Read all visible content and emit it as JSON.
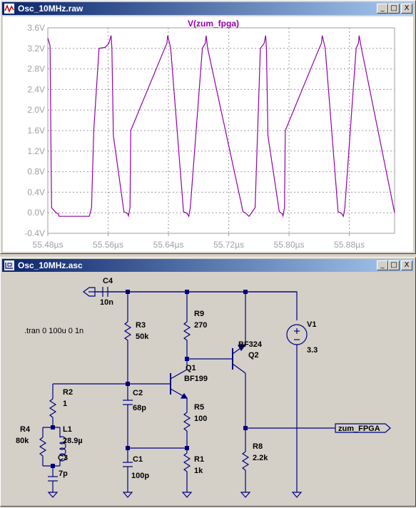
{
  "waveform_window": {
    "title": "Osc_10MHz.raw",
    "trace_label": "V(zum_fpga)",
    "buttons": {
      "minimize": "_",
      "maximize": "□",
      "close": "X"
    }
  },
  "schematic_window": {
    "title": "Osc_10MHz.asc",
    "buttons": {
      "minimize": "_",
      "maximize": "□",
      "close": "X"
    },
    "directive": ".tran 0 100u 0 1n",
    "net_label": "zum_FPGA",
    "components": {
      "c4": {
        "name": "C4",
        "value": "10n"
      },
      "r3": {
        "name": "R3",
        "value": "50k"
      },
      "r9": {
        "name": "R9",
        "value": "270"
      },
      "q2": {
        "name": "Q2",
        "model": "BF324"
      },
      "v1": {
        "name": "V1",
        "value": "3.3"
      },
      "q1": {
        "name": "Q1",
        "model": "BF199"
      },
      "r2": {
        "name": "R2",
        "value": "1"
      },
      "c2": {
        "name": "C2",
        "value": "68p"
      },
      "r5": {
        "name": "R5",
        "value": "100"
      },
      "r4": {
        "name": "R4",
        "value": "80k"
      },
      "l1": {
        "name": "L1",
        "value": "28.9µ"
      },
      "r8": {
        "name": "R8",
        "value": "2.2k"
      },
      "c3": {
        "name": "C3",
        "value": "7p"
      },
      "c1": {
        "name": "C1",
        "value": "100p"
      },
      "r1": {
        "name": "R1",
        "value": "1k"
      }
    }
  },
  "colors": {
    "trace": "#9400a8",
    "grid": "#9c9c9c",
    "axis_text": "#a0a0a0",
    "wire": "#000080",
    "schematic_bg": "#d4d0c8",
    "title_active": "#0a246a"
  },
  "chart_data": {
    "type": "line",
    "title": "V(zum_fpga)",
    "xlabel": "",
    "ylabel": "",
    "x_ticks": [
      "55.48µs",
      "55.56µs",
      "55.64µs",
      "55.72µs",
      "55.80µs",
      "55.88µs"
    ],
    "y_ticks": [
      "3.6V",
      "3.2V",
      "2.8V",
      "2.4V",
      "2.0V",
      "1.6V",
      "1.2V",
      "0.8V",
      "0.4V",
      "0.0V",
      "-0.4V"
    ],
    "xlim": [
      55.48,
      55.94
    ],
    "ylim": [
      -0.4,
      3.6
    ],
    "grid": true,
    "series": [
      {
        "name": "V(zum_fpga)",
        "x": [
          55.48,
          55.483,
          55.484,
          55.485,
          55.491,
          55.494,
          55.495,
          55.535,
          55.538,
          55.541,
          55.548,
          55.556,
          55.561,
          55.564,
          55.565,
          55.567,
          55.581,
          55.586,
          55.587,
          55.589,
          55.59,
          55.635,
          55.638,
          55.639,
          55.643,
          55.66,
          55.663,
          55.665,
          55.667,
          55.669,
          55.685,
          55.689,
          55.69,
          55.692,
          55.739,
          55.742,
          55.743,
          55.747,
          55.755,
          55.762,
          55.767,
          55.769,
          55.77,
          55.772,
          55.787,
          55.791,
          55.792,
          55.794,
          55.795,
          55.84,
          55.843,
          55.844,
          55.848,
          55.865,
          55.868,
          55.87,
          55.872,
          55.874,
          55.889,
          55.892,
          55.893,
          55.896,
          55.94
        ],
        "y": [
          3.4,
          3.25,
          1.6,
          0.1,
          0.0,
          -0.02,
          -0.07,
          -0.07,
          0.1,
          1.6,
          3.2,
          3.22,
          3.3,
          3.45,
          3.2,
          1.5,
          0.02,
          -0.02,
          -0.06,
          0.1,
          1.6,
          3.2,
          3.3,
          3.45,
          3.2,
          0.02,
          0.0,
          -0.02,
          -0.07,
          0.1,
          3.2,
          3.3,
          3.45,
          3.2,
          0.02,
          0.0,
          -0.02,
          -0.07,
          0.1,
          3.2,
          3.3,
          3.45,
          3.2,
          1.5,
          0.02,
          -0.02,
          -0.06,
          0.1,
          1.6,
          3.2,
          3.3,
          3.45,
          3.2,
          0.02,
          0.0,
          -0.02,
          -0.07,
          0.1,
          3.2,
          3.3,
          3.45,
          3.2,
          0.0
        ]
      }
    ]
  }
}
